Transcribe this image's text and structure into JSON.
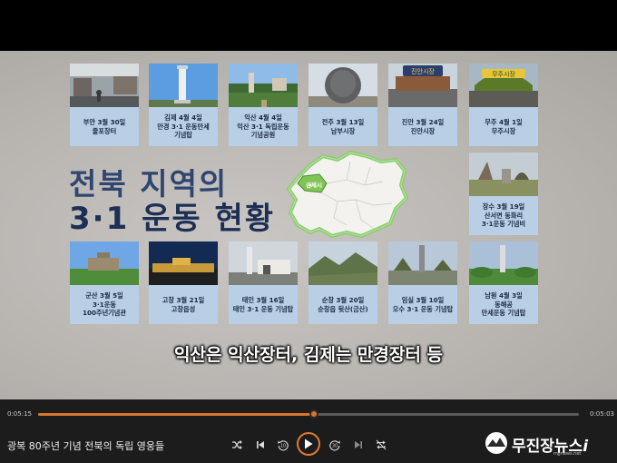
{
  "slide": {
    "title_line1": "전북 지역의",
    "title_line2": "3·1 운동 현황",
    "map_label": "김제시",
    "subtitle": "익산은 익산장터, 김제는 만경장터 등",
    "cards": [
      {
        "line1": "부안 3월 30일",
        "line2": "줄포장터",
        "line3": ""
      },
      {
        "line1": "김제 4월 4일",
        "line2": "만경 3·1 운동만세",
        "line3": "기념탑"
      },
      {
        "line1": "익산 4월 4일",
        "line2": "익산 3·1 독립운동",
        "line3": "기념공원"
      },
      {
        "line1": "전주 3월 13일",
        "line2": "남부시장",
        "line3": ""
      },
      {
        "line1": "진안 3월 24일",
        "line2": "진안시장",
        "line3": ""
      },
      {
        "line1": "무주 4월 1일",
        "line2": "무주시장",
        "line3": ""
      },
      {
        "line1": "장수 3월 19일",
        "line2": "산서면 동화리",
        "line3": "3·1운동 기념비"
      },
      {
        "line1": "군산 3월 5일",
        "line2": "3·1운동",
        "line3": "100주년기념관"
      },
      {
        "line1": "고창 3월 21일",
        "line2": "고창읍성",
        "line3": ""
      },
      {
        "line1": "태인 3월 16일",
        "line2": "태인 3·1 운동 기념탑",
        "line3": ""
      },
      {
        "line1": "순창 3월 20일",
        "line2": "순창읍 뒷산(금산)",
        "line3": ""
      },
      {
        "line1": "임실 3월 10일",
        "line2": "오수 3·1 운동 기념탑",
        "line3": ""
      },
      {
        "line1": "남원 4월 3일",
        "line2": "동해공",
        "line3": "만세운동 기념탑"
      }
    ],
    "photo_signs": {
      "jinan": "진안시장",
      "muju": "무주시장"
    }
  },
  "player": {
    "time_current": "0:05:15",
    "time_total": "0:05:03",
    "progress": 0.51,
    "video_title": "광복 80주년 기념 전북의 독립 영웅들",
    "accent": "#d9742b"
  },
  "logo": {
    "name": "무진장뉴스",
    "suffix": "i",
    "url": "mjjnews.net"
  }
}
